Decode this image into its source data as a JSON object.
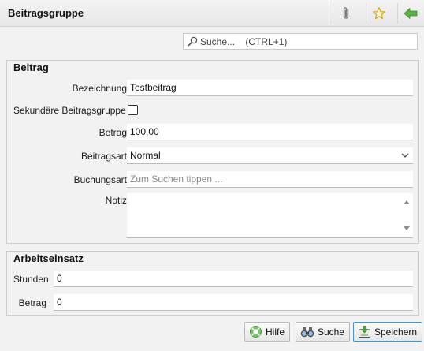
{
  "window": {
    "title": "Beitragsgruppe"
  },
  "toolbar": {
    "icons": [
      "paperclip-icon",
      "star-icon",
      "back-arrow-icon"
    ],
    "accent_green": "#4caf3a",
    "star_color": "#e0b020"
  },
  "search": {
    "placeholder": "Suche...    (CTRL+1)"
  },
  "beitrag": {
    "title": "Beitrag",
    "bezeichnung_label": "Bezeichnung",
    "bezeichnung_value": "Testbeitrag",
    "sekundaer_label": "Sekundäre Beitragsgruppe",
    "sekundaer_checked": false,
    "betrag_label": "Betrag",
    "betrag_value": "100,00",
    "beitragsart_label": "Beitragsart",
    "beitragsart_value": "Normal",
    "buchungsart_label": "Buchungsart",
    "buchungsart_placeholder": "Zum Suchen tippen ...",
    "notiz_label": "Notiz",
    "notiz_value": ""
  },
  "arbeitseinsatz": {
    "title": "Arbeitseinsatz",
    "stunden_label": "Stunden",
    "stunden_value": "0",
    "betrag_label": "Betrag",
    "betrag_value": "0"
  },
  "buttons": {
    "hilfe": "Hilfe",
    "suche": "Suche",
    "speichern": "Speichern"
  }
}
